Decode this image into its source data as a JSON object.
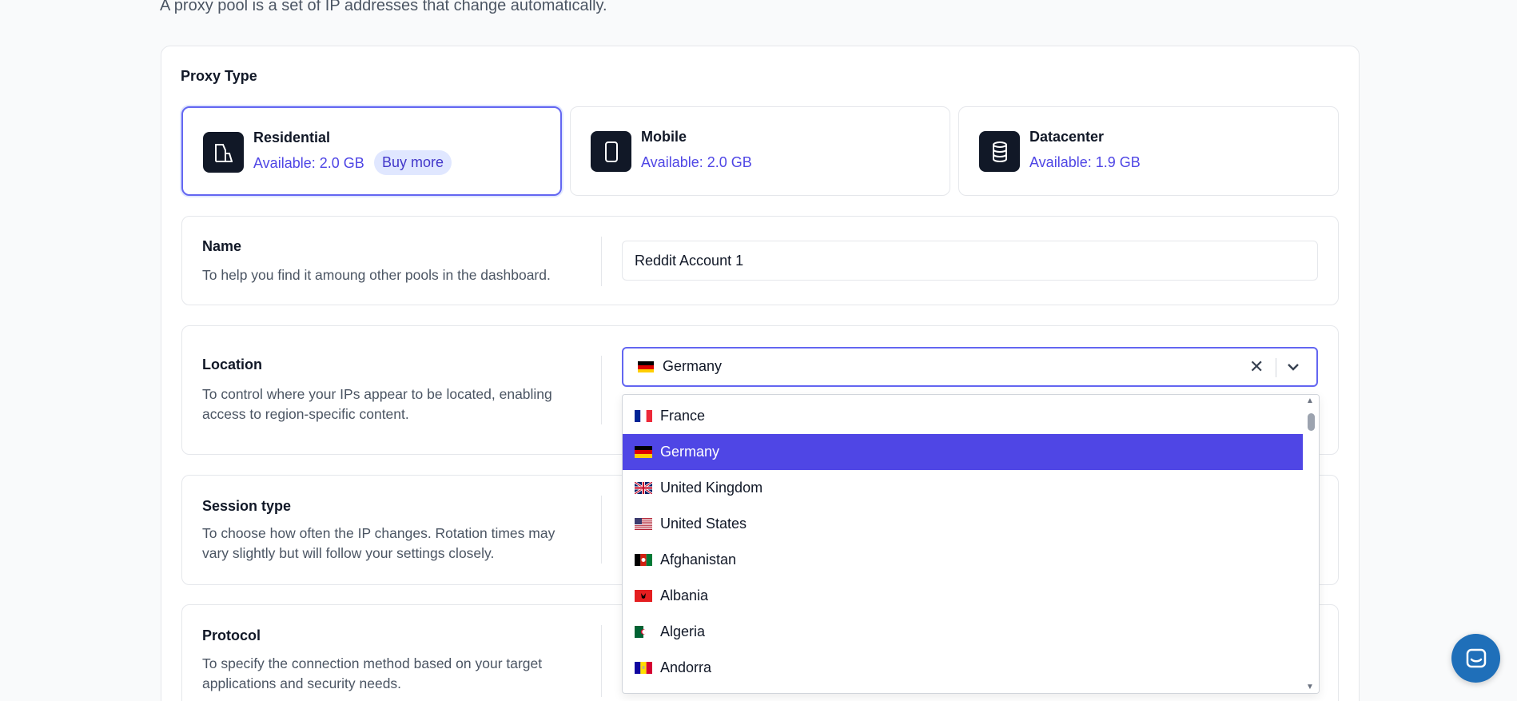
{
  "intro_text": "A proxy pool is a set of IP addresses that change automatically.",
  "proxy_type": {
    "title": "Proxy Type",
    "options": [
      {
        "name": "Residential",
        "available": "Available: 2.0 GB",
        "buy_more": "Buy more",
        "selected": true,
        "icon": "building-icon"
      },
      {
        "name": "Mobile",
        "available": "Available: 2.0 GB",
        "selected": false,
        "icon": "phone-icon"
      },
      {
        "name": "Datacenter",
        "available": "Available: 1.9 GB",
        "selected": false,
        "icon": "database-icon"
      }
    ]
  },
  "name_section": {
    "label": "Name",
    "description": "To help you find it amoung other pools in the dashboard.",
    "value": "Reddit Account 1"
  },
  "location_section": {
    "label": "Location",
    "description": "To control where your IPs appear to be located, enabling access to region-specific content.",
    "selected": "Germany",
    "options": [
      "France",
      "Germany",
      "United Kingdom",
      "United States",
      "Afghanistan",
      "Albania",
      "Algeria",
      "Andorra"
    ]
  },
  "session_section": {
    "label": "Session type",
    "description": "To choose how often the IP changes. Rotation times may vary slightly but will follow your settings closely."
  },
  "protocol_section": {
    "label": "Protocol",
    "description": "To specify the connection method based on your target applications and security needs."
  },
  "colors": {
    "accent": "#4f46e5",
    "selected_border": "#6366f1",
    "chat_button": "#1f6fb9"
  }
}
